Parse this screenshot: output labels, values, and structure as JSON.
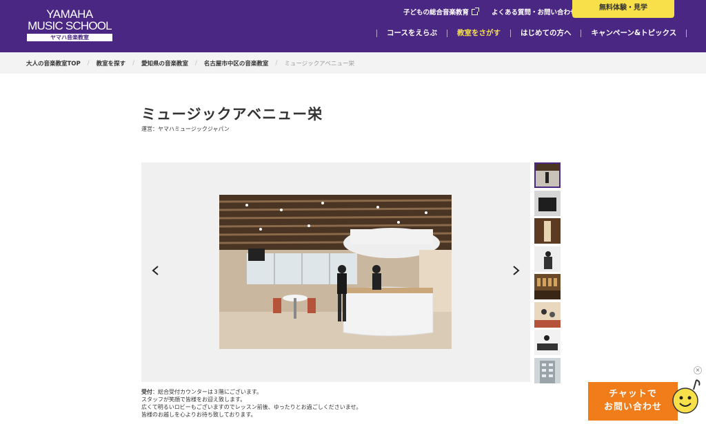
{
  "header": {
    "logo": {
      "line1": "YAMAHA",
      "line2": "MUSIC SCHOOL",
      "sub": "ヤマハ音楽教室"
    },
    "util_links": {
      "kids": "子どもの総合音楽教育",
      "faq": "よくある質問・お問い合わせ"
    },
    "trial_button": "無料体験・見学",
    "nav": [
      {
        "label": "コースをえらぶ",
        "active": false
      },
      {
        "label": "教室をさがす",
        "active": true
      },
      {
        "label": "はじめての方へ",
        "active": false
      },
      {
        "label": "キャンペーン&トピックス",
        "active": false
      }
    ],
    "colors": {
      "brand": "#4b2784",
      "accent": "#f7e04a"
    }
  },
  "breadcrumb": [
    "大人の音楽教室TOP",
    "教室を探す",
    "愛知県の音楽教室",
    "名古屋市中区の音楽教室",
    "ミュージックアベニュー栄"
  ],
  "page": {
    "title": "ミュージックアベニュー栄",
    "operator": "運営：ヤマハミュージックジャパン"
  },
  "gallery": {
    "prev_icon": "chevron-left-icon",
    "next_icon": "chevron-right-icon",
    "thumb_count": 8,
    "selected_index": 0
  },
  "description": {
    "label": "受付",
    "line1": "：総合受付カウンターは３階にございます。",
    "line2": "スタッフが笑顔で皆様をお迎え致します。",
    "line3": "広くて明るいロビーもございますのでレッスン前後、ゆったりとお過ごしくださいませ。",
    "line4": "皆様のお越しを心よりお待ち致しております。"
  },
  "chat": {
    "line1": "チャットで",
    "line2": "お問い合わせ",
    "close": "×",
    "color": "#f07d1a"
  }
}
